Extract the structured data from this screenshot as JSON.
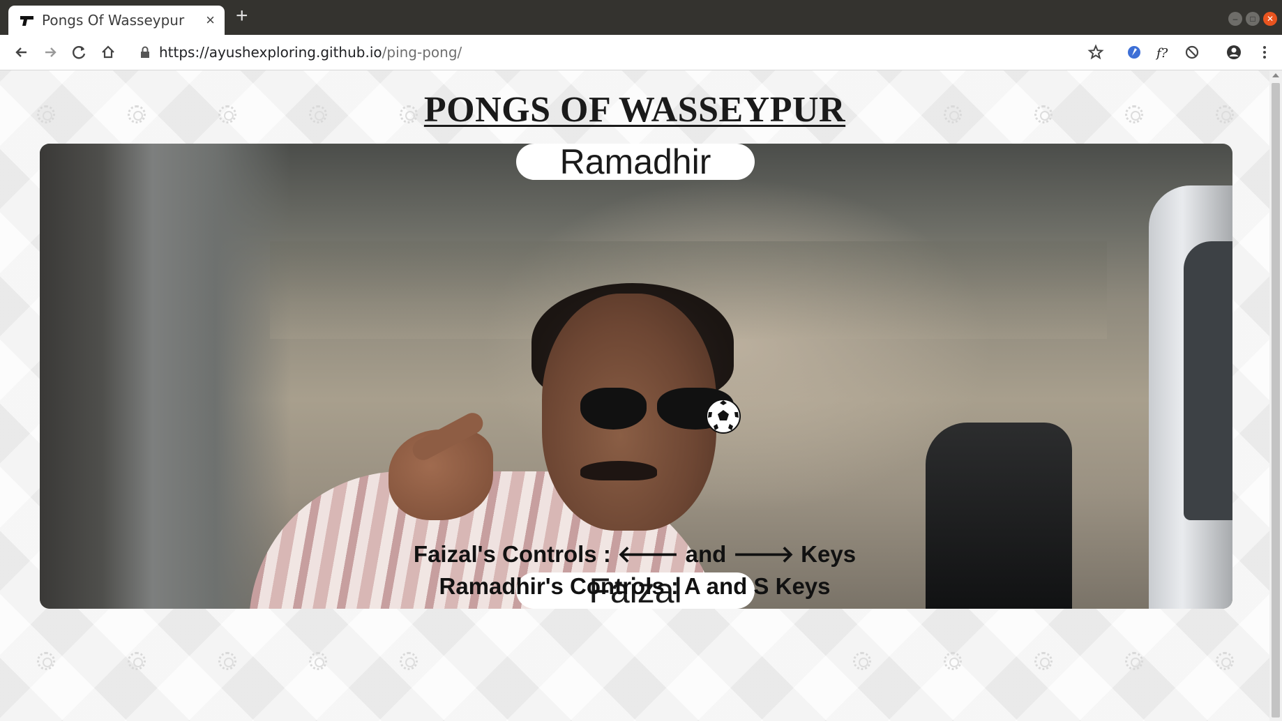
{
  "browser": {
    "tab_title": "Pongs Of Wasseypur",
    "tab_close": "×",
    "new_tab": "+",
    "url_main": "https://ayushexploring.github.io",
    "url_path": "/ping-pong/"
  },
  "page": {
    "title": "PONGS OF WASSEYPUR",
    "top_player": "Ramadhir",
    "bottom_player": "Faizal",
    "faizal_controls": {
      "prefix": "Faizal's Controls : ",
      "left_arrow": "🡐",
      "and": " and ",
      "right_arrow": "🡒",
      "suffix": " Keys"
    },
    "ramadhir_controls": "Ramadhir's Controls : A and S Keys"
  },
  "colors": {
    "tabbar": "#34332f",
    "close_button": "#e9541f",
    "paddle": "#ffffff",
    "title": "#1a1a1a"
  }
}
